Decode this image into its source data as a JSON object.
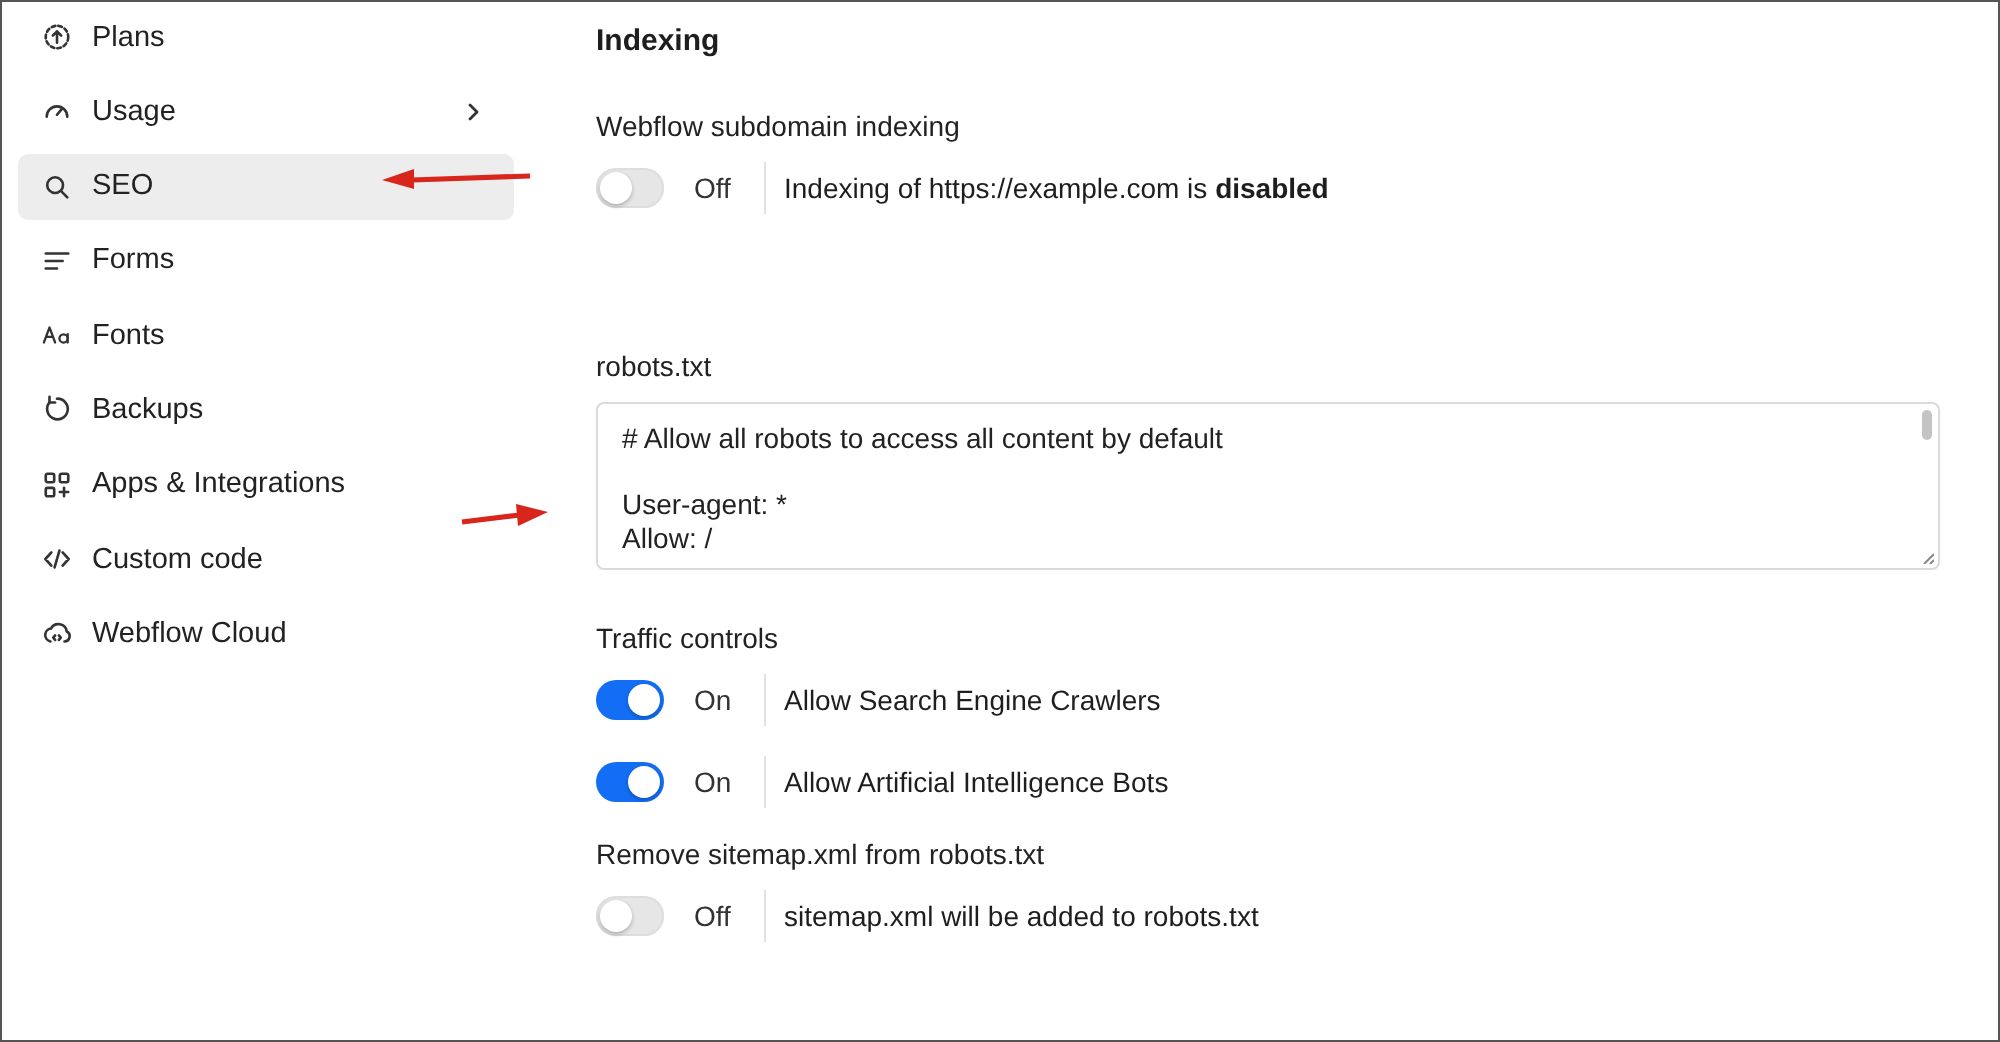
{
  "sidebar": {
    "items": [
      {
        "label": "Plans",
        "selected": false,
        "expandable": false
      },
      {
        "label": "Usage",
        "selected": false,
        "expandable": true
      },
      {
        "label": "SEO",
        "selected": true,
        "expandable": false
      },
      {
        "label": "Forms",
        "selected": false,
        "expandable": false
      },
      {
        "label": "Fonts",
        "selected": false,
        "expandable": false
      },
      {
        "label": "Backups",
        "selected": false,
        "expandable": false
      },
      {
        "label": "Apps & Integrations",
        "selected": false,
        "expandable": false
      },
      {
        "label": "Custom code",
        "selected": false,
        "expandable": false
      },
      {
        "label": "Webflow Cloud",
        "selected": false,
        "expandable": false
      }
    ]
  },
  "main": {
    "title": "Indexing",
    "sections": [
      {
        "kind": "toggles",
        "label": "Webflow subdomain indexing",
        "toggles": [
          {
            "on": false,
            "state_text": "Off",
            "description": "Indexing of https://example.com is **disabled**"
          }
        ]
      },
      {
        "kind": "textarea",
        "label": "robots.txt",
        "value": "# Allow all robots to access all content by default\n\nUser-agent: *\nAllow: /"
      },
      {
        "kind": "toggles",
        "label": "Traffic controls",
        "toggles": [
          {
            "on": true,
            "state_text": "On",
            "description": "Allow Search Engine Crawlers"
          },
          {
            "on": true,
            "state_text": "On",
            "description": "Allow Artificial Intelligence Bots"
          }
        ]
      },
      {
        "kind": "toggles",
        "label": "Remove sitemap.xml from robots.txt",
        "toggles": [
          {
            "on": false,
            "state_text": "Off",
            "description": "sitemap.xml will be added to robots.txt"
          }
        ]
      }
    ]
  }
}
